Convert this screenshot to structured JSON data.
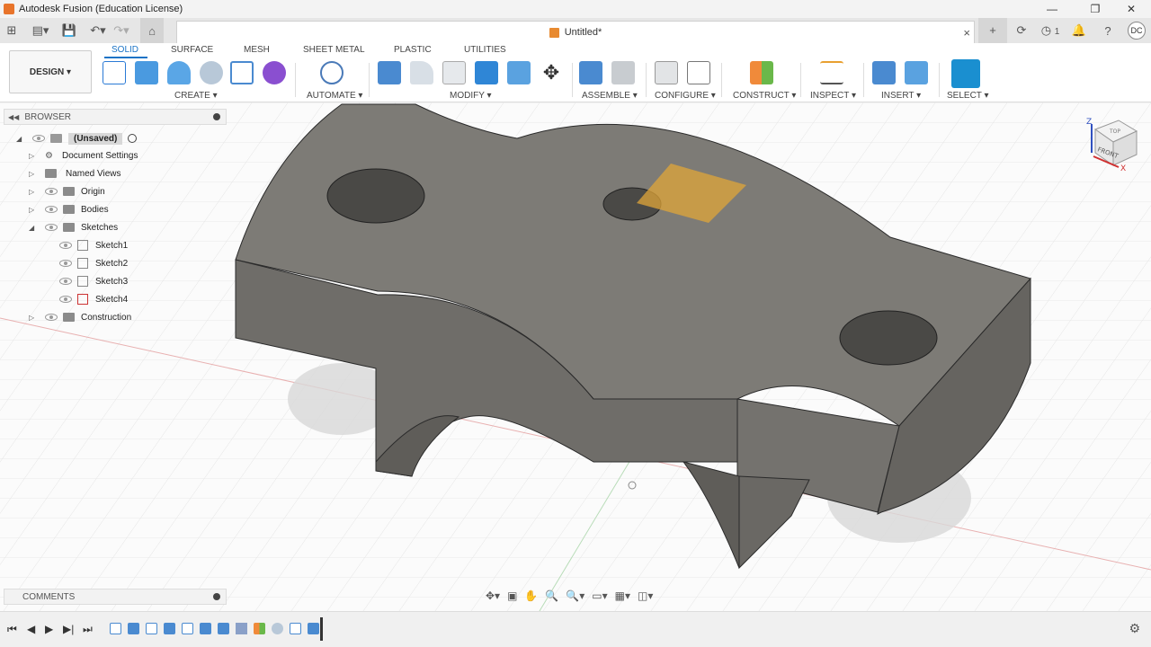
{
  "window": {
    "title": "Autodesk Fusion (Education License)",
    "minimize": "—",
    "maximize": "❐",
    "close": "✕"
  },
  "document": {
    "tab_title": "Untitled*",
    "close": "×",
    "user_initials": "DC",
    "job_count": "1"
  },
  "workspace": {
    "design_label": "DESIGN",
    "tabs": [
      "SOLID",
      "SURFACE",
      "MESH",
      "SHEET METAL",
      "PLASTIC",
      "UTILITIES"
    ],
    "groups": [
      "CREATE",
      "AUTOMATE",
      "MODIFY",
      "ASSEMBLE",
      "CONFIGURE",
      "CONSTRUCT",
      "INSPECT",
      "INSERT",
      "SELECT"
    ]
  },
  "browser": {
    "title": "BROWSER",
    "root": "(Unsaved)",
    "items": [
      "Document Settings",
      "Named Views",
      "Origin",
      "Bodies",
      "Sketches",
      "Sketch1",
      "Sketch2",
      "Sketch3",
      "Sketch4",
      "Construction"
    ]
  },
  "comments": {
    "title": "COMMENTS"
  },
  "viewcube": {
    "face": "FRONT",
    "top": "TOP",
    "z": "Z",
    "x": "X"
  },
  "colors": {
    "accent": "#1a73c6",
    "model_face": "#7d7b76",
    "model_side": "#6a6864",
    "selection": "#e0a63a"
  }
}
